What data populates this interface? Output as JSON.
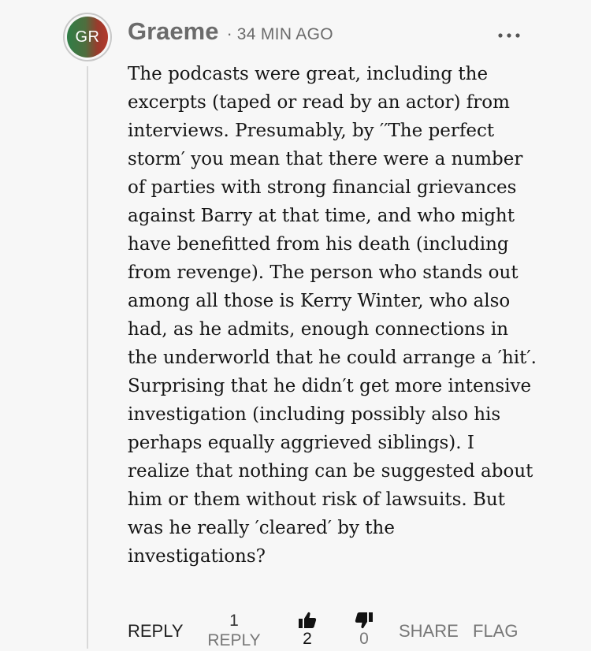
{
  "comment": {
    "avatar_initials": "GR",
    "author": "Graeme",
    "separator": "·",
    "time_ago": "34 MIN AGO",
    "more_icon": "more-horizontal-icon",
    "text": "The podcasts were great, including the excerpts (taped or read by an actor) from interviews. Presumably, by ′′The perfect storm′ you mean that there were a number of parties with strong financial grievances against Barry at that time, and who might have benefitted from his death (including from revenge). The person who stands out among all those is Kerry Winter, who also had, as he admits, enough connections in the underworld that he could arrange a ′hit′. Surprising that he didn′t get more intensive investigation (including possibly also his perhaps equally aggrieved siblings). I realize that nothing can be suggested about him or them without risk of lawsuits. But was he really ′cleared′ by the investigations?"
  },
  "actions": {
    "reply_label": "REPLY",
    "replies_count": "1",
    "replies_label": "REPLY",
    "upvote_icon": "thumbs-up-icon",
    "upvote_count": "2",
    "downvote_icon": "thumbs-down-icon",
    "downvote_count": "0",
    "share_label": "SHARE",
    "flag_label": "FLAG"
  },
  "colors": {
    "background": "#f7f7f7",
    "avatar_green": "#2f7d46",
    "avatar_red": "#b23a2c",
    "muted_text": "#6b6b6b"
  }
}
